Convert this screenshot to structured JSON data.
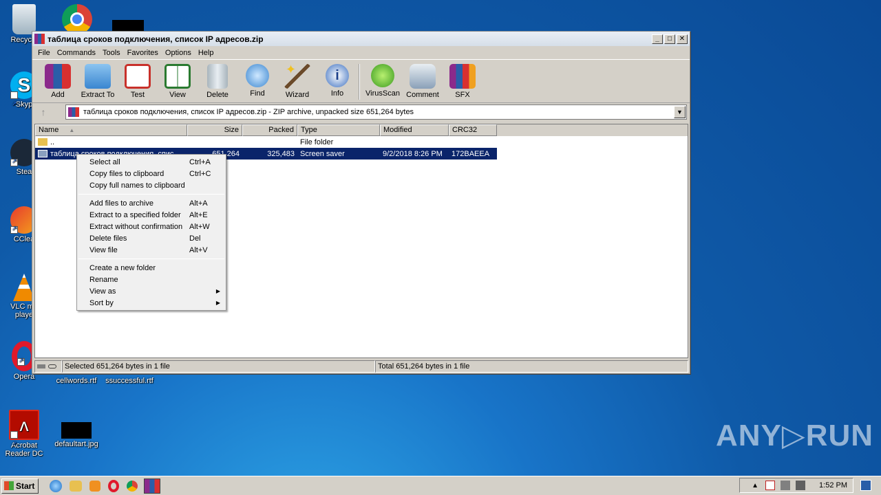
{
  "desktop": {
    "icons": [
      {
        "label": "Recycle"
      },
      {
        "label": "Skyp"
      },
      {
        "label": "Stea"
      },
      {
        "label": "CClea"
      },
      {
        "label": "VLC me\nplaye"
      },
      {
        "label": "Opera"
      },
      {
        "label": "cellwords.rtf"
      },
      {
        "label": "ssuccessful.rtf"
      },
      {
        "label": "Acrobat\nReader DC"
      },
      {
        "label": "defaultart.jpg"
      }
    ]
  },
  "window": {
    "title": "таблица сроков подключения, список IP адресов.zip",
    "menu": [
      "File",
      "Commands",
      "Tools",
      "Favorites",
      "Options",
      "Help"
    ],
    "toolbar": [
      "Add",
      "Extract To",
      "Test",
      "View",
      "Delete",
      "Find",
      "Wizard",
      "Info",
      "VirusScan",
      "Comment",
      "SFX"
    ],
    "address": "таблица сроков подключения, список IP адресов.zip - ZIP archive, unpacked size 651,264 bytes",
    "columns": [
      "Name",
      "Size",
      "Packed",
      "Type",
      "Modified",
      "CRC32"
    ],
    "rows": [
      {
        "name": "..",
        "size": "",
        "packed": "",
        "type": "File folder",
        "modified": "",
        "crc": ""
      },
      {
        "name": "таблица сроков подключения, спис",
        "size": "651,264",
        "packed": "325,483",
        "type": "Screen saver",
        "modified": "9/2/2018 8:26 PM",
        "crc": "172BAEEA"
      }
    ],
    "status_left": "Selected 651,264 bytes in 1 file",
    "status_right": "Total 651,264 bytes in 1 file"
  },
  "context_menu": {
    "groups": [
      [
        {
          "label": "Select all",
          "shortcut": "Ctrl+A"
        },
        {
          "label": "Copy files to clipboard",
          "shortcut": "Ctrl+C"
        },
        {
          "label": "Copy full names to clipboard",
          "shortcut": ""
        }
      ],
      [
        {
          "label": "Add files to archive",
          "shortcut": "Alt+A"
        },
        {
          "label": "Extract to a specified folder",
          "shortcut": "Alt+E"
        },
        {
          "label": "Extract without confirmation",
          "shortcut": "Alt+W"
        },
        {
          "label": "Delete files",
          "shortcut": "Del"
        },
        {
          "label": "View file",
          "shortcut": "Alt+V"
        }
      ],
      [
        {
          "label": "Create a new folder",
          "shortcut": ""
        },
        {
          "label": "Rename",
          "shortcut": ""
        },
        {
          "label": "View as",
          "shortcut": "",
          "submenu": true
        },
        {
          "label": "Sort by",
          "shortcut": "",
          "submenu": true
        }
      ]
    ]
  },
  "taskbar": {
    "start_label": "Start",
    "clock": "1:52 PM"
  },
  "watermark": "ANY▷RUN"
}
